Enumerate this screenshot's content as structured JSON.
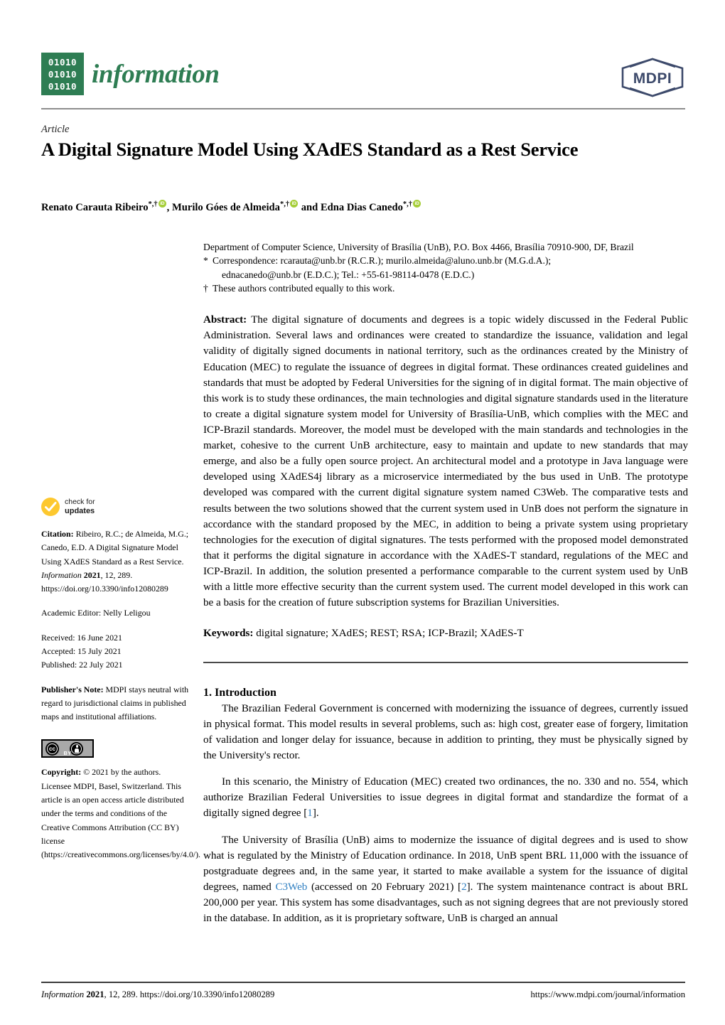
{
  "header": {
    "logo_binary_rows": [
      "01010",
      "01010",
      "01010"
    ],
    "journal_name": "information",
    "publisher_logo": "MDPI",
    "logo_green": "#2e7d53",
    "publisher_navy": "#3d4a6b"
  },
  "article": {
    "type": "Article",
    "title": "A Digital Signature Model Using XAdES Standard as a Rest Service",
    "authors_html": "Renato Carauta Ribeiro *,† ORCID, Murilo Góes de Almeida *,† ORCID and Edna Dias Canedo *,† ORCID",
    "author_list": [
      {
        "name": "Renato Carauta Ribeiro",
        "marks": "*,†",
        "orcid": true
      },
      {
        "name": "Murilo Góes de Almeida",
        "marks": "*,†",
        "orcid": true
      },
      {
        "name": "Edna Dias Canedo",
        "marks": "*,†",
        "orcid": true
      }
    ],
    "author_connector": "and"
  },
  "affiliation": {
    "department": "Department of Computer Science, University of Brasília (UnB), P.O. Box 4466, Brasília 70910-900, DF, Brazil",
    "correspondence_marker": "*",
    "correspondence_line1": "Correspondence: rcarauta@unb.br (R.C.R.); murilo.almeida@aluno.unb.br (M.G.d.A.);",
    "correspondence_line2": "ednacanedo@unb.br (E.D.C.); Tel.: +55-61-98114-0478 (E.D.C.)",
    "dagger_marker": "†",
    "equal_contribution": "These authors contributed equally to this work."
  },
  "abstract": {
    "label": "Abstract:",
    "text": "The digital signature of documents and degrees is a topic widely discussed in the Federal Public Administration. Several laws and ordinances were created to standardize the issuance, validation and legal validity of digitally signed documents in national territory, such as the ordinances created by the Ministry of Education (MEC) to regulate the issuance of degrees in digital format. These ordinances created guidelines and standards that must be adopted by Federal Universities for the signing of in digital format. The main objective of this work is to study these ordinances, the main technologies and digital signature standards used in the literature to create a digital signature system model for University of Brasília-UnB, which complies with the MEC and ICP-Brazil standards. Moreover, the model must be developed with the main standards and technologies in the market, cohesive to the current UnB architecture, easy to maintain and update to new standards that may emerge, and also be a fully open source project. An architectural model and a prototype in Java language were developed using XAdES4j library as a microservice intermediated by the bus used in UnB. The prototype developed was compared with the current digital signature system named C3Web. The comparative tests and results between the two solutions showed that the current system used in UnB does not perform the signature in accordance with the standard proposed by the MEC, in addition to being a private system using proprietary technologies for the execution of digital signatures. The tests performed with the proposed model demonstrated that it performs the digital signature in accordance with the XAdES-T standard, regulations of the MEC and ICP-Brazil. In addition, the solution presented a performance comparable to the current system used by UnB with a little more effective security than the current system used. The current model developed in this work can be a basis for the creation of future subscription systems for Brazilian Universities."
  },
  "keywords": {
    "label": "Keywords:",
    "text": "digital signature; XAdES; REST; RSA; ICP-Brazil; XAdES-T"
  },
  "introduction": {
    "heading": "1. Introduction",
    "paragraphs": [
      {
        "pre": "The Brazilian Federal Government is concerned with modernizing the issuance of degrees, currently issued in physical format. This model results in several problems, such as: high cost, greater ease of forgery, limitation of validation and longer delay for issuance, because in addition to printing, they must be physically signed by the University's rector.",
        "link": "",
        "post": ""
      },
      {
        "pre": "In this scenario, the Ministry of Education (MEC) created two ordinances, the no. 330 and no. 554, which authorize Brazilian Federal Universities to issue degrees in digital format and standardize the format of a digitally signed degree [",
        "link": "1",
        "post": "]."
      }
    ],
    "para3": {
      "seg1": "The University of Brasília (UnB) aims to modernize the issuance of digital degrees and is used to show what is regulated by the Ministry of Education ordinance. In 2018, UnB spent BRL 11,000 with the issuance of postgraduate degrees and, in the same year, it started to make available a system for the issuance of digital degrees, named ",
      "link1": "C3Web",
      "seg2": " (accessed on 20 February 2021) [",
      "link2": "2",
      "seg3": "]. The system maintenance contract is about BRL 200,000 per year. This system has some disadvantages, such as not signing degrees that are not previously stored in the database. In addition, as it is proprietary software, UnB is charged an annual"
    },
    "link_color": "#2f7fc1"
  },
  "sidebar": {
    "check_updates": {
      "line1": "check for",
      "line2": "updates",
      "badge_color": "#fdc82f"
    },
    "citation": {
      "label": "Citation:",
      "text_part1": "Ribeiro, R.C.; de Almeida, M.G.; Canedo, E.D. A Digital Signature Model Using XAdES Standard as a Rest Service. ",
      "journal": "Information",
      "year": "2021",
      "volume_page": ", 12, 289. ",
      "doi": "https://doi.org/10.3390/info12080289"
    },
    "academic_editor": "Academic Editor: Nelly Leligou",
    "received": "Received: 16 June 2021",
    "accepted": "Accepted: 15 July 2021",
    "published": "Published: 22 July 2021",
    "publishers_note": {
      "label": "Publisher's Note:",
      "text": " MDPI stays neutral with regard to jurisdictional claims in published maps and institutional affiliations."
    },
    "cc_badge": {
      "cc": "cc",
      "by": "BY",
      "bg_color": "#a9a9a9"
    },
    "copyright": {
      "label": "Copyright:",
      "text": " © 2021 by the authors. Licensee MDPI, Basel, Switzerland. This article is an open access article distributed under the terms and conditions of the Creative Commons Attribution (CC BY) license (https://creativecommons.org/licenses/by/4.0/)."
    }
  },
  "footer": {
    "journal": "Information",
    "year": "2021",
    "citation_rest": ", 12, 289. https://doi.org/10.3390/info12080289",
    "url": "https://www.mdpi.com/journal/information"
  }
}
